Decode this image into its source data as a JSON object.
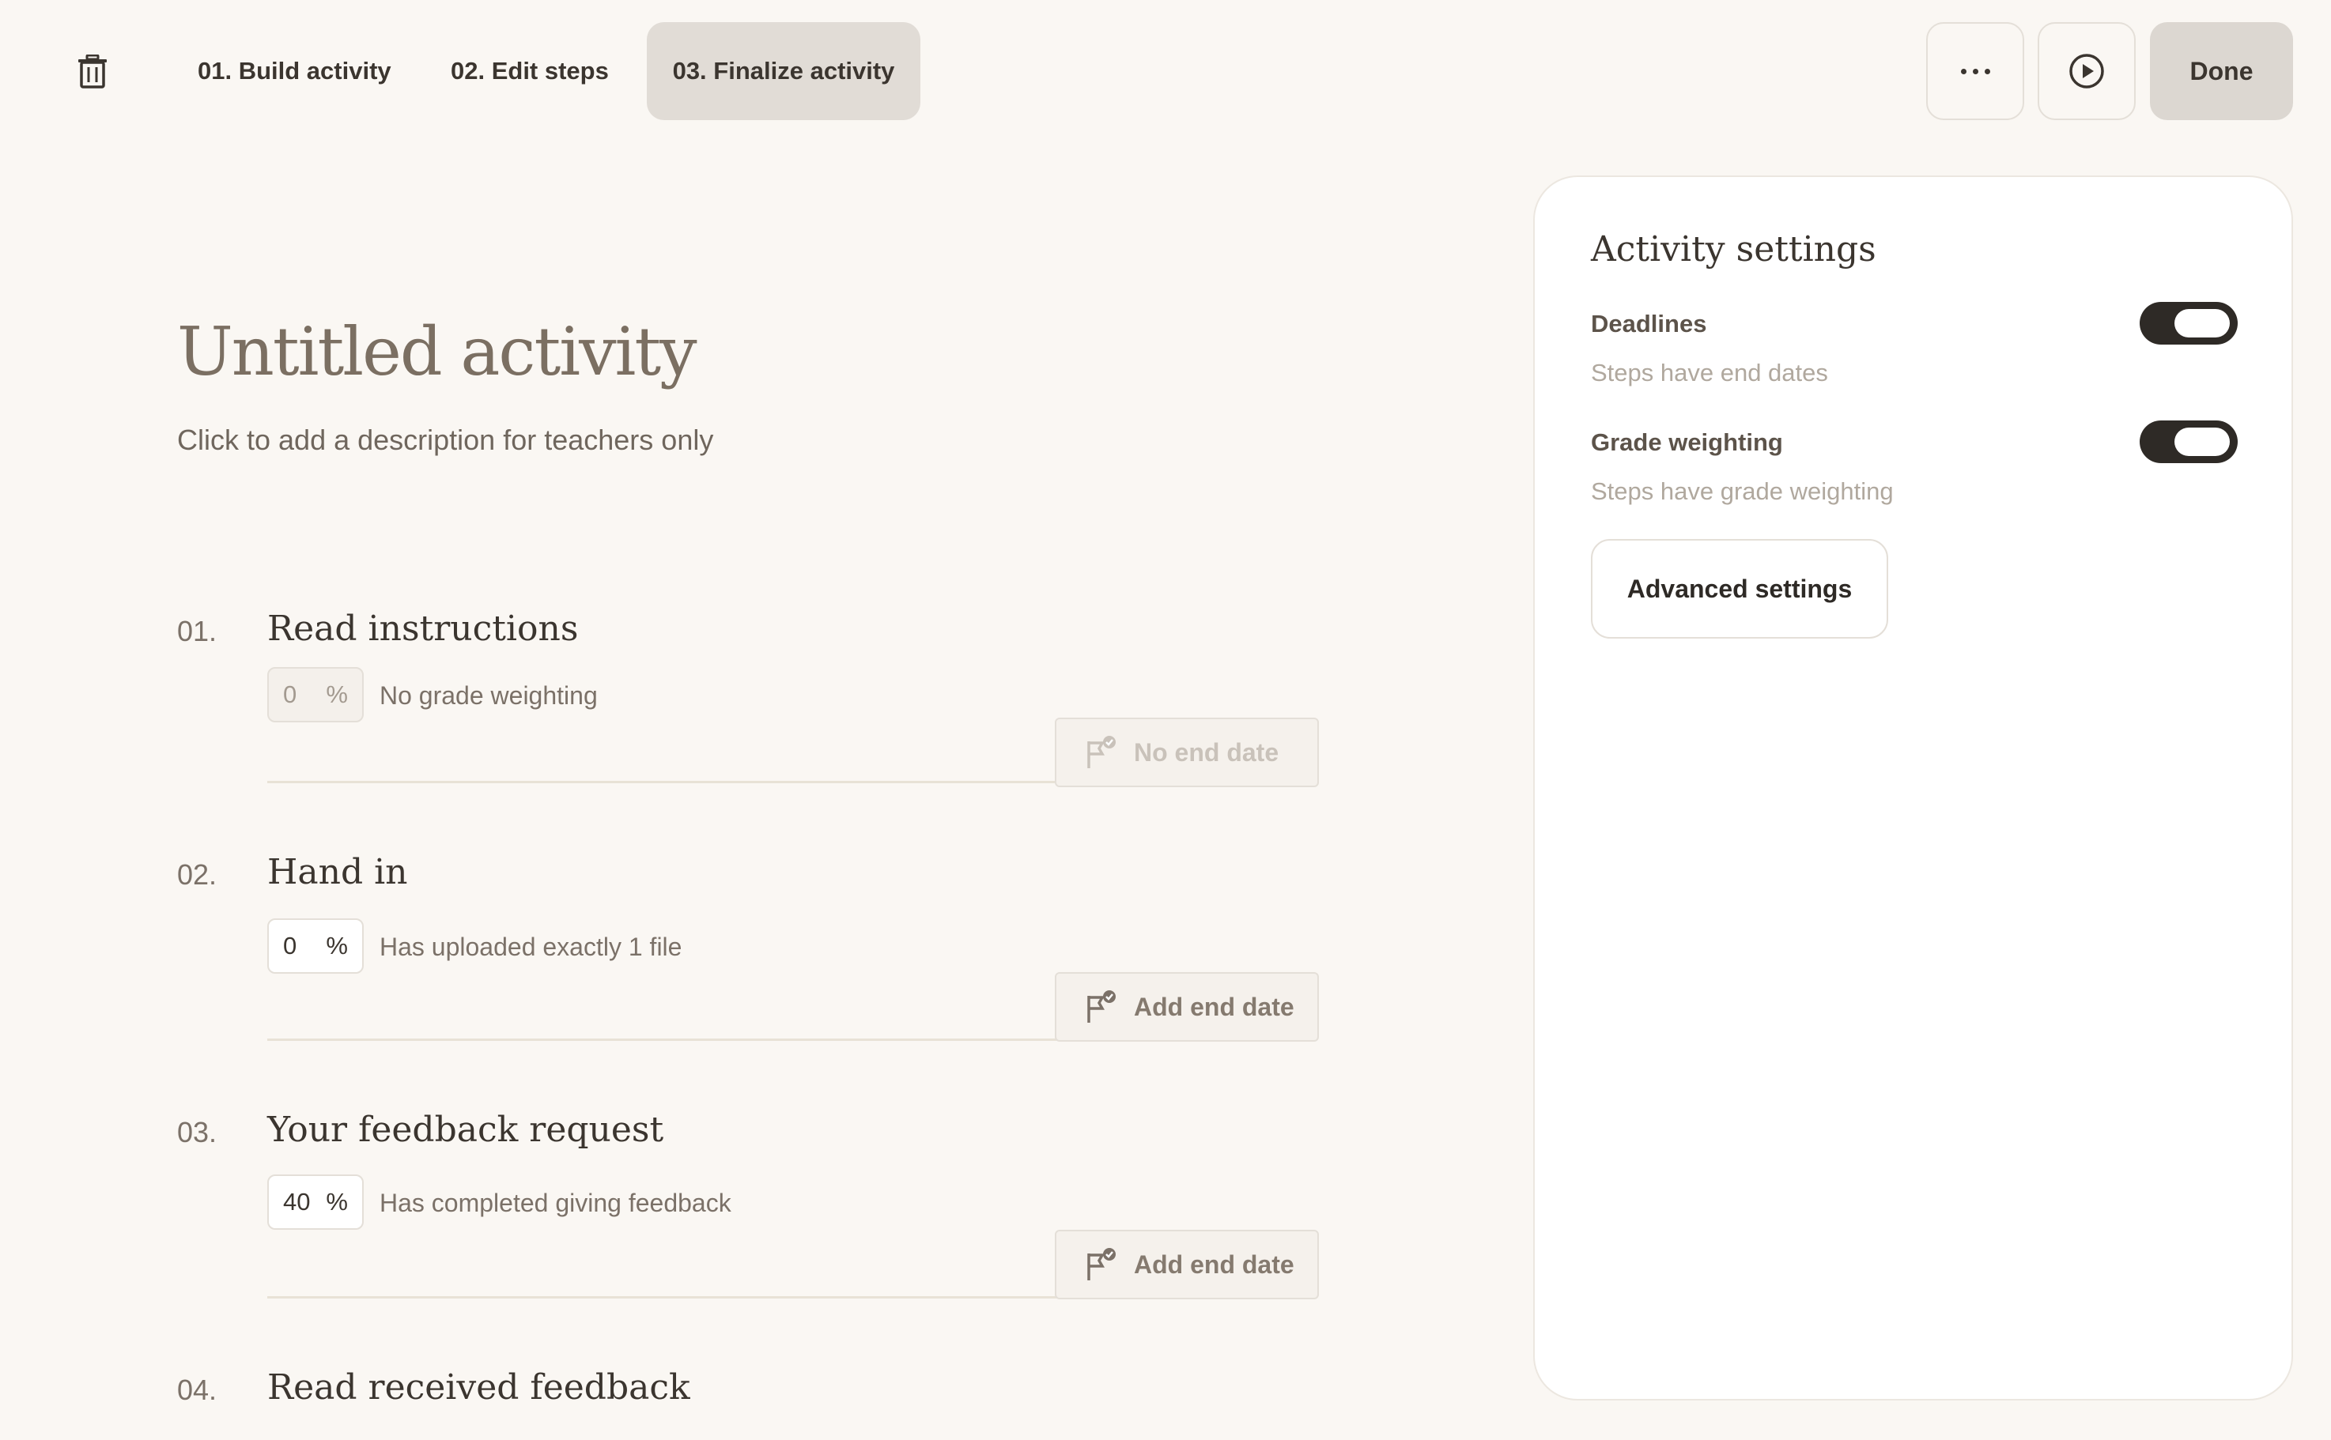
{
  "tabs": [
    {
      "label": "01. Build activity"
    },
    {
      "label": "02. Edit steps"
    },
    {
      "label": "03. Finalize activity",
      "active": true
    }
  ],
  "toolbar": {
    "more_icon": "ellipsis-icon",
    "play_icon": "play-circle-icon",
    "done_label": "Done",
    "delete_icon": "trash-icon"
  },
  "activity": {
    "title": "Untitled activity",
    "description": "Click to add a description for teachers only"
  },
  "steps": [
    {
      "num": "01.",
      "title": "Read instructions",
      "weight": "0",
      "unit": "%",
      "condition": "No grade weighting",
      "date_label": "No end date",
      "disabled": true
    },
    {
      "num": "02.",
      "title": "Hand in",
      "weight": "0",
      "unit": "%",
      "condition": "Has uploaded exactly 1 file",
      "date_label": "Add end date",
      "disabled": false
    },
    {
      "num": "03.",
      "title": "Your feedback request",
      "weight": "40",
      "unit": "%",
      "condition": "Has completed giving feedback",
      "date_label": "Add end date",
      "disabled": false
    },
    {
      "num": "04.",
      "title": "Read received feedback"
    }
  ],
  "settings": {
    "title": "Activity settings",
    "deadlines": {
      "label": "Deadlines",
      "sub": "Steps have end dates",
      "on": true
    },
    "grade_weighting": {
      "label": "Grade weighting",
      "sub": "Steps have grade weighting",
      "on": true
    },
    "advanced_label": "Advanced settings"
  },
  "colors": {
    "background": "#faf7f3",
    "active_tab": "#e1dcd6",
    "toggle_on": "#2e2a26",
    "panel": "#ffffff"
  }
}
